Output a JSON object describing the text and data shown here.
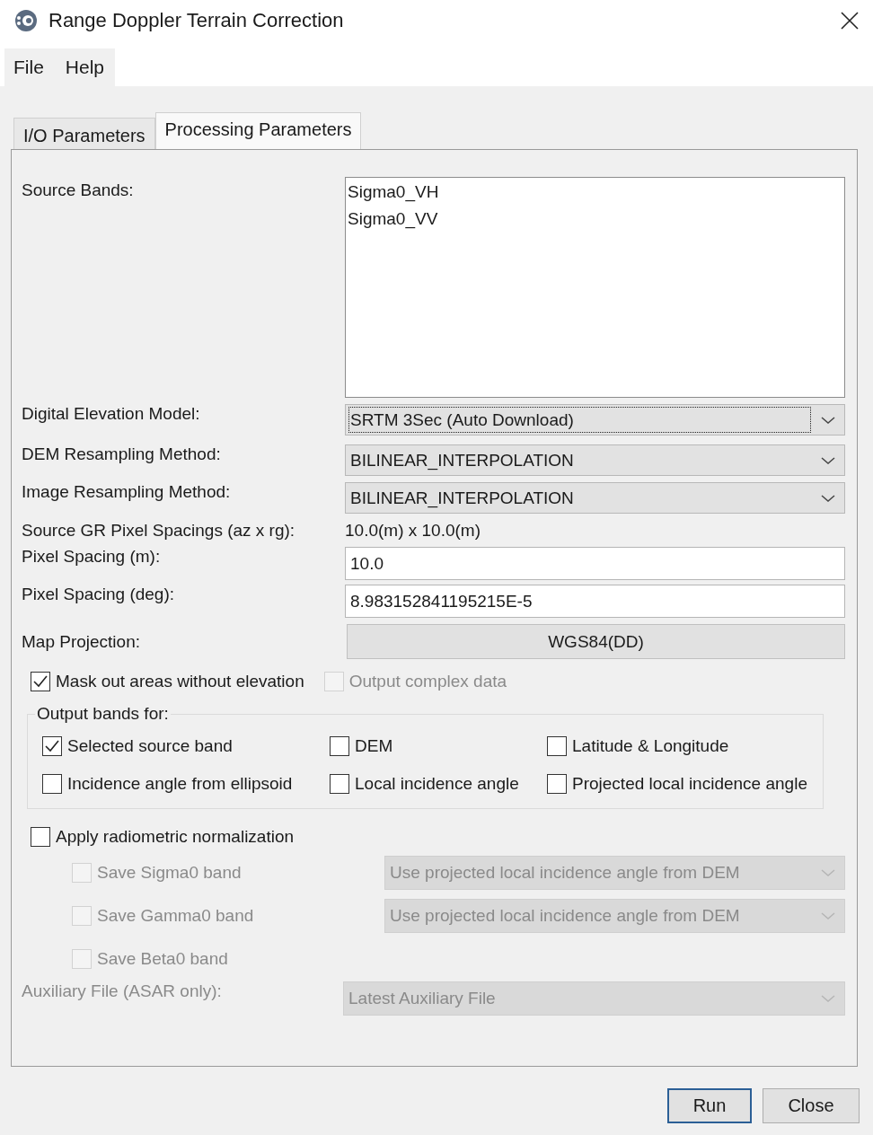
{
  "window": {
    "title": "Range Doppler Terrain Correction"
  },
  "menu": [
    {
      "label": "File"
    },
    {
      "label": "Help"
    }
  ],
  "tabs": [
    {
      "label": "I/O Parameters",
      "selected": false
    },
    {
      "label": "Processing Parameters",
      "selected": true
    }
  ],
  "source_bands": {
    "label": "Source Bands:",
    "items": [
      "Sigma0_VH",
      "Sigma0_VV"
    ]
  },
  "params": [
    {
      "kind": "combo",
      "label": "Digital Elevation Model:",
      "value": "SRTM 3Sec (Auto Download)",
      "focused": true
    },
    {
      "kind": "combo",
      "label": "DEM Resampling Method:",
      "value": "BILINEAR_INTERPOLATION",
      "focused": false
    },
    {
      "kind": "combo",
      "label": "Image Resampling Method:",
      "value": "BILINEAR_INTERPOLATION",
      "focused": false
    },
    {
      "kind": "text",
      "label": "Source GR Pixel Spacings (az x rg):",
      "value": "10.0(m) x 10.0(m)"
    },
    {
      "kind": "field",
      "label": "Pixel Spacing (m):",
      "value": "10.0"
    },
    {
      "kind": "field",
      "label": "Pixel Spacing (deg):",
      "value": "8.983152841195215E-5"
    },
    {
      "kind": "button",
      "label": "Map Projection:",
      "value": "WGS84(DD)"
    }
  ],
  "options": [
    {
      "label": "Mask out areas without elevation",
      "checked": true,
      "disabled": false
    },
    {
      "label": "Output complex data",
      "checked": false,
      "disabled": true
    }
  ],
  "output_bands": {
    "title": "Output bands for:",
    "items": [
      {
        "label": "Selected source band",
        "checked": true
      },
      {
        "label": "DEM",
        "checked": false
      },
      {
        "label": "Latitude & Longitude",
        "checked": false
      },
      {
        "label": "Incidence angle from ellipsoid",
        "checked": false
      },
      {
        "label": "Local incidence angle",
        "checked": false
      },
      {
        "label": "Projected local incidence angle",
        "checked": false
      }
    ]
  },
  "radiometric": {
    "label": "Apply radiometric normalization",
    "checked": false
  },
  "radiometric_items": [
    {
      "label": "Save Sigma0 band",
      "checked": false,
      "disabled": true,
      "method": "Use projected local incidence angle from DEM"
    },
    {
      "label": "Save Gamma0 band",
      "checked": false,
      "disabled": true,
      "method": "Use projected local incidence angle from DEM"
    },
    {
      "label": "Save Beta0 band",
      "checked": false,
      "disabled": true
    }
  ],
  "auxiliary": {
    "label": "Auxiliary File (ASAR only):",
    "value": "Latest Auxiliary File",
    "disabled": true
  },
  "buttons": [
    {
      "label": "Run",
      "default": true
    },
    {
      "label": "Close",
      "default": false
    }
  ]
}
